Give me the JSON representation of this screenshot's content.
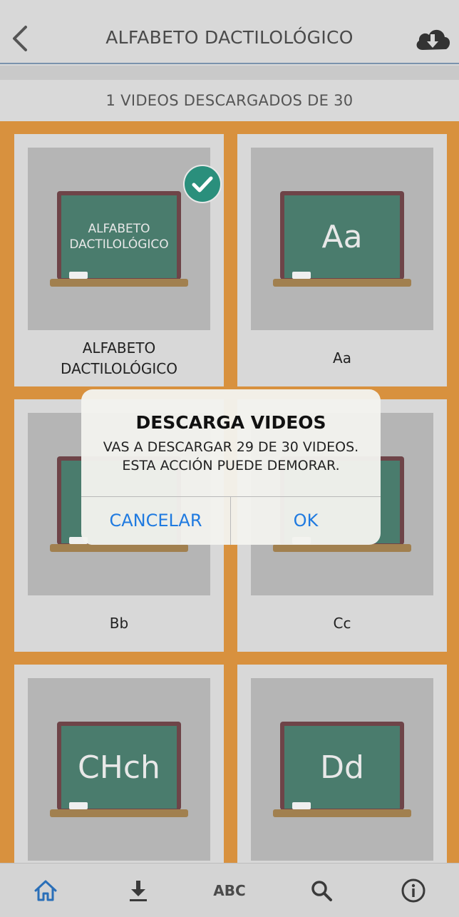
{
  "header": {
    "title": "ALFABETO DACTILOLÓGICO",
    "back_icon": "chevron-left-icon",
    "download_icon": "cloud-download-icon"
  },
  "counter_text": "1 VIDEOS DESCARGADOS DE 30",
  "cards": [
    {
      "board_text": "ALFABETO DACTILOLÓGICO",
      "label": "ALFABETO DACTILOLÓGICO",
      "downloaded": true
    },
    {
      "board_text": "Aa",
      "label": "Aa",
      "downloaded": false
    },
    {
      "board_text": "",
      "label": "Bb",
      "downloaded": false
    },
    {
      "board_text": "",
      "label": "Cc",
      "downloaded": false
    },
    {
      "board_text": "CHch",
      "label": "",
      "downloaded": false
    },
    {
      "board_text": "Dd",
      "label": "",
      "downloaded": false
    }
  ],
  "dialog": {
    "title": "DESCARGA VIDEOS",
    "message_line1": "VAS A DESCARGAR 29 DE 30 VIDEOS.",
    "message_line2": "ESTA ACCIÓN PUEDE DEMORAR.",
    "cancel_label": "CANCELAR",
    "ok_label": "OK"
  },
  "tabbar": {
    "abc_label": "ABC",
    "icons": [
      "home-icon",
      "download-icon",
      "abc-icon",
      "search-icon",
      "info-icon"
    ]
  },
  "colors": {
    "accent_blue": "#1f7ae0",
    "background_orange": "#d8913e",
    "chalkboard_green": "#4a7c6d",
    "check_teal": "#2a8f7c"
  }
}
